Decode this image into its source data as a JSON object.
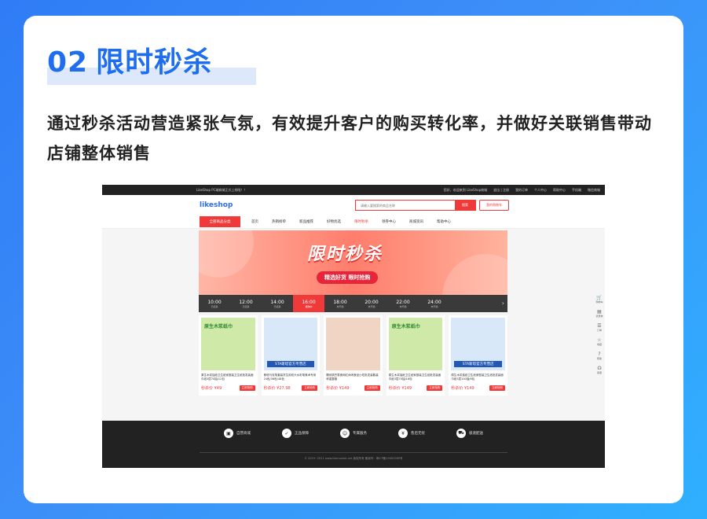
{
  "heading": {
    "number": "02",
    "title": "限时秒杀"
  },
  "description": "通过秒杀活动营造紧张气氛，有效提升客户的购买转化率，并做好关联销售带动店铺整体销售",
  "shop": {
    "topbar": {
      "notice": "LikeShop PC端商城正式上线啦！！",
      "links": [
        "您好，欢迎来到 LikeShop商城",
        "退出 | 注册",
        "我的订单",
        "个人中心",
        "帮助中心",
        "手机端",
        "微信商城"
      ]
    },
    "logo": "likeshop",
    "search": {
      "placeholder": "请输入要搜索的商品名称",
      "button": "搜索"
    },
    "cart_button": "我的购物车",
    "nav": {
      "category_button": "全部商品分类",
      "items": [
        "首页",
        "热销榜单",
        "新品推荐",
        "好物优选",
        "限时秒杀",
        "领券中心",
        "商城资讯",
        "帮助中心"
      ],
      "active_index": 4
    },
    "banner": {
      "title": "限时秒杀",
      "subtitle": "精选好货 限时抢购"
    },
    "time_slots": [
      {
        "time": "10:00",
        "status": "已结束"
      },
      {
        "time": "12:00",
        "status": "已结束"
      },
      {
        "time": "14:00",
        "status": "已结束"
      },
      {
        "time": "16:00",
        "status": "抢购中"
      },
      {
        "time": "18:00",
        "status": "未开始"
      },
      {
        "time": "20:00",
        "status": "未开始"
      },
      {
        "time": "22:00",
        "status": "未开始"
      },
      {
        "time": "24:00",
        "status": "未开始"
      }
    ],
    "active_slot": 3,
    "products": [
      {
        "img_label": "原生木浆纸巾",
        "img_tag": "",
        "title": "原生木浆抽纸卫生纸家庭装卫生纸批发装面巾纸3层70抽/12包",
        "price": "秒杀价 ¥49",
        "button": "立即抢购",
        "theme": "green"
      },
      {
        "img_label": "",
        "img_tag": "STA斯塔官方专营店",
        "title": "斯塔马克笔套装学生用双头水彩笔美术专用 24色/36色/48色",
        "price": "秒杀价 ¥27.98",
        "button": "立即抢购",
        "theme": "blue"
      },
      {
        "img_label": "",
        "img_tag": "",
        "title": "糯米锅巴零食网红休闲食品小吃批发装散装称重整箱",
        "price": "秒杀价 ¥149",
        "button": "立即抢购",
        "theme": "red"
      },
      {
        "img_label": "原生木浆纸巾",
        "img_tag": "",
        "title": "原生木浆抽纸卫生纸家庭装卫生纸批发装面巾纸3层70抽/18包",
        "price": "秒杀价 ¥149",
        "button": "立即抢购",
        "theme": "green"
      },
      {
        "img_label": "",
        "img_tag": "STA斯塔官方专营店",
        "title": "原生木浆抽纸卫生纸家庭装卫生纸批发装面巾纸3层100抽/6包",
        "price": "秒杀价 ¥149",
        "button": "立即抢购",
        "theme": "blue"
      }
    ],
    "sidebar": [
      "购物车",
      "优惠券",
      "订单",
      "收藏",
      "帮助",
      "客服"
    ],
    "footer": {
      "features": [
        "自营商城",
        "正品保障",
        "专属服务",
        "售后无忧",
        "极速配送"
      ],
      "copyright": "© 2019~2021 www.likemarket.net 版权所有 备案号：粤ICP备19081989号"
    }
  }
}
